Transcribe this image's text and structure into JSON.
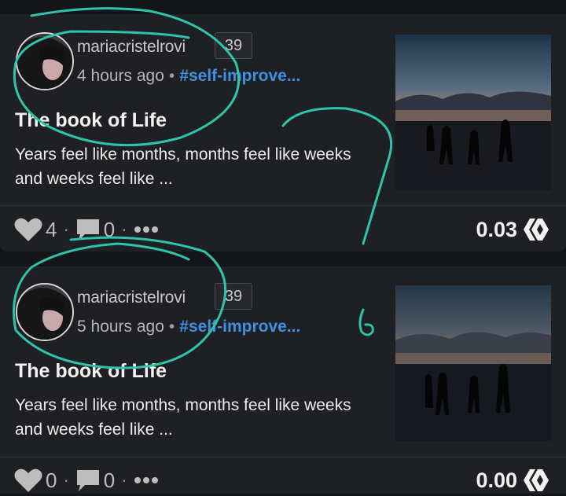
{
  "posts": [
    {
      "author": "mariacristelrovi",
      "reputation": "39",
      "time": "4 hours ago",
      "tag": "#self-improve...",
      "title": "The book of Life",
      "summary": "Years feel like months, months feel like weeks and weeks feel like ...",
      "votes": "4",
      "comments": "0",
      "payout": "0.03"
    },
    {
      "author": "mariacristelrovi",
      "reputation": "39",
      "time": "5 hours ago",
      "tag": "#self-improve...",
      "title": "The book of Life",
      "summary": "Years feel like months, months feel like weeks and weeks feel like ...",
      "votes": "0",
      "comments": "0",
      "payout": "0.00"
    }
  ],
  "meta_separator": "•",
  "footer_separator": "·",
  "more_icon": "more-dots-icon",
  "colors": {
    "background": "#141518",
    "card": "#1e2023",
    "tag": "#3f8fe4",
    "annotation": "#2ec4a9"
  }
}
